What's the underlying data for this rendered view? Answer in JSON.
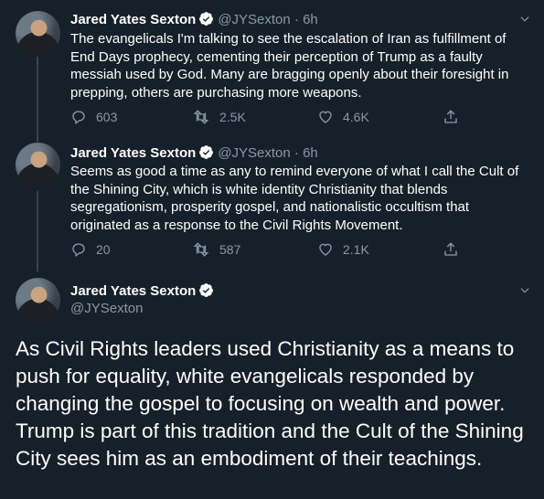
{
  "tweets": [
    {
      "name": "Jared Yates Sexton",
      "handle": "@JYSexton",
      "time": "· 6h",
      "text": "The evangelicals I'm talking to see the escalation of Iran as fulfillment of End Days prophecy, cementing their perception of Trump as a faulty messiah used by God. Many are bragging openly about their foresight in prepping, others are purchasing more weapons.",
      "replies": "603",
      "retweets": "2.5K",
      "likes": "4.6K"
    },
    {
      "name": "Jared Yates Sexton",
      "handle": "@JYSexton",
      "time": "· 6h",
      "text": "Seems as good a time as any to remind everyone of what I call the Cult of the Shining City, which is white identity Christianity that blends segregationism, prosperity gospel, and nationalistic occultism that originated as a response to the Civil Rights Movement.",
      "replies": "20",
      "retweets": "587",
      "likes": "2.1K"
    }
  ],
  "main_tweet": {
    "name": "Jared Yates Sexton",
    "handle": "@JYSexton",
    "text": "As Civil Rights leaders used Christianity as a means to push for equality, white evangelicals responded by changing the gospel to focusing on wealth and power. Trump is part of this tradition and the Cult of the Shining City sees him as an embodiment of their teachings."
  },
  "colors": {
    "background": "#15202b",
    "secondary_text": "#8899a6",
    "verified": "#ffffff",
    "thread_line": "#38444d"
  }
}
